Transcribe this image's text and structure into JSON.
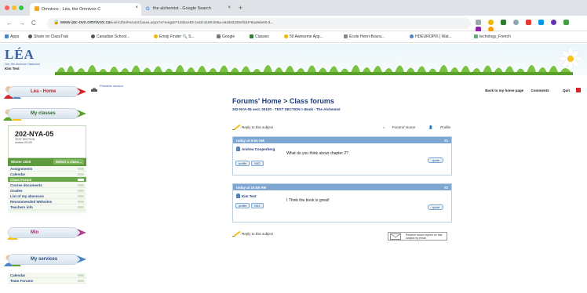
{
  "browser": {
    "tabs": [
      {
        "label": "Omnivox - Léa, the Omnivox C",
        "active": true
      },
      {
        "label": "the alchemist - Google Search",
        "active": false
      }
    ],
    "new_tab": "+",
    "url_host": "www-jac-ovx.omnivox.ca",
    "url_path": "/cvir/ctfm/ForumClasse.aspx?a=msg&t=13d4ce53-1e4d-4109-b06a-c64352326efd&t=8aa9de00-d...",
    "bookmarks": [
      "Apps",
      "Share on ClassTrak",
      "Canadian School...",
      "Emoji Finder 🔍 S...",
      "Google",
      "Classes",
      "50 Awesome App...",
      "École Henri-Boura...",
      "HDEUROPIX | Wat...",
      "techology_French"
    ]
  },
  "header": {
    "logo": "LÉA",
    "logo_sub": "Léa, the Omnivox Classroom",
    "user": "Kim Test"
  },
  "sidebar": {
    "home": "Léa - Home",
    "my_classes": "My classes",
    "class_code": "202-NYA-05",
    "class_sub1": "TEST SECTION",
    "class_sub2": "section 00100",
    "semester": "Winter 2020",
    "select_class": "Select a class...",
    "menu": [
      {
        "label": "Assignments",
        "active": false
      },
      {
        "label": "Calendar",
        "active": false
      },
      {
        "label": "Class Forum",
        "active": true
      },
      {
        "label": "Course documents",
        "active": false
      },
      {
        "label": "Grades",
        "active": false
      },
      {
        "label": "List of my absences",
        "active": false
      },
      {
        "label": "Recommended Websites",
        "active": false
      },
      {
        "label": "Teachers info",
        "active": false
      }
    ],
    "mio": "Mio",
    "my_services": "My services",
    "services": [
      "Calendar",
      "Team Forums"
    ]
  },
  "toolbar": {
    "printable": "Printable version",
    "back": "Back to my home page",
    "comments": "Comments",
    "quit": "Quit"
  },
  "forum": {
    "title": "Forums' Home > Class forums",
    "path": "202-NYA-05 sect. 00100 - TEST SECTION > Book - The Alchemist",
    "reply": "Reply to this subject",
    "forums_home": "Forums' Home",
    "profile": "Profile",
    "notify": "Receive future replies on this subject by email",
    "posts": [
      {
        "time": "today at 9:54 AM",
        "num": "#1",
        "author": "Andrea Cooperberg",
        "message": "What do you think about chapter 2?",
        "profile": "profile",
        "mio": "MIO",
        "quote": "quote"
      },
      {
        "time": "today at 10:58 AM",
        "num": "#2",
        "author": "Kim Test",
        "message": "I Think the book is great!",
        "profile": "profile",
        "mio": "MIO",
        "quote": "quote"
      }
    ]
  }
}
